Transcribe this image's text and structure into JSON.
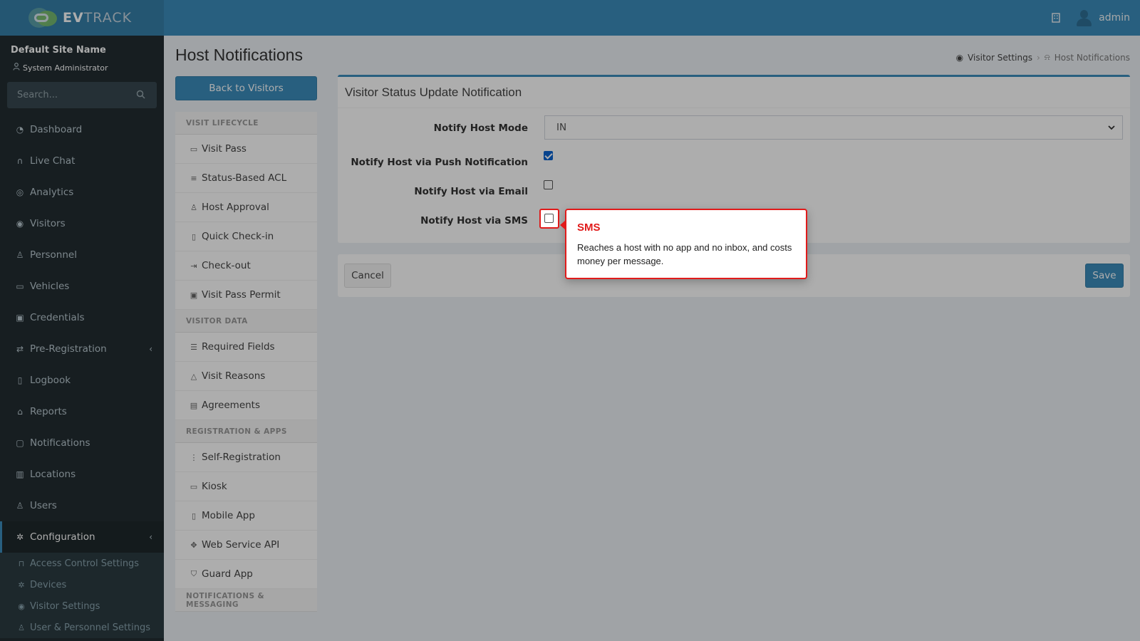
{
  "header": {
    "logo_prefix": "EV",
    "logo_suffix": "TRACK",
    "user_name": "admin"
  },
  "sidebar": {
    "site_name": "Default Site Name",
    "role": "System Administrator",
    "search_placeholder": "Search...",
    "items": [
      {
        "label": "Dashboard",
        "icon": "dashboard-icon"
      },
      {
        "label": "Live Chat",
        "icon": "headset-icon"
      },
      {
        "label": "Analytics",
        "icon": "analytics-icon"
      },
      {
        "label": "Visitors",
        "icon": "eye-icon"
      },
      {
        "label": "Personnel",
        "icon": "person-icon"
      },
      {
        "label": "Vehicles",
        "icon": "car-icon"
      },
      {
        "label": "Credentials",
        "icon": "id-card-icon"
      },
      {
        "label": "Pre-Registration",
        "icon": "arrows-icon"
      },
      {
        "label": "Logbook",
        "icon": "book-icon"
      },
      {
        "label": "Reports",
        "icon": "report-icon"
      },
      {
        "label": "Notifications",
        "icon": "chat-icon"
      },
      {
        "label": "Locations",
        "icon": "map-icon"
      },
      {
        "label": "Users",
        "icon": "users-icon"
      },
      {
        "label": "Configuration",
        "icon": "gear-icon"
      }
    ],
    "sub_items": [
      {
        "label": "Access Control Settings",
        "icon": "lock-icon"
      },
      {
        "label": "Devices",
        "icon": "device-icon"
      },
      {
        "label": "Visitor Settings",
        "icon": "eye-icon"
      },
      {
        "label": "User & Personnel Settings",
        "icon": "user-settings-icon"
      }
    ]
  },
  "page": {
    "title": "Host Notifications",
    "breadcrumb": [
      "Visitor Settings",
      "Host Notifications"
    ],
    "back_button": "Back to Visitors"
  },
  "settings_nav": {
    "sections": [
      {
        "header": "VISIT LIFECYCLE",
        "items": [
          "Visit Pass",
          "Status-Based ACL",
          "Host Approval",
          "Quick Check-in",
          "Check-out",
          "Visit Pass Permit"
        ]
      },
      {
        "header": "VISITOR DATA",
        "items": [
          "Required Fields",
          "Visit Reasons",
          "Agreements"
        ]
      },
      {
        "header": "REGISTRATION & APPS",
        "items": [
          "Self-Registration",
          "Kiosk",
          "Mobile App",
          "Web Service API",
          "Guard App"
        ]
      },
      {
        "header": "NOTIFICATIONS & MESSAGING",
        "items": []
      }
    ]
  },
  "form": {
    "title": "Visitor Status Update Notification",
    "mode_label": "Notify Host Mode",
    "mode_value": "IN",
    "push_label": "Notify Host via Push Notification",
    "push_checked": true,
    "email_label": "Notify Host via Email",
    "email_checked": false,
    "sms_label": "Notify Host via SMS",
    "sms_checked": false,
    "cancel_label": "Cancel",
    "save_label": "Save"
  },
  "tooltip": {
    "title": "SMS",
    "body": "Reaches a host with no app and no inbox, and costs money per message.",
    "accent_color": "#e11b1b"
  },
  "colors": {
    "header_blue": "#3c8dbc",
    "sidebar_dark": "#222d32"
  }
}
